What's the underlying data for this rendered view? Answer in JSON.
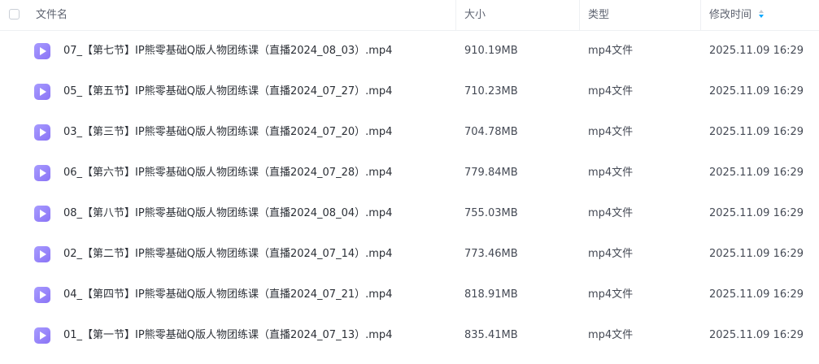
{
  "header": {
    "name_label": "文件名",
    "size_label": "大小",
    "type_label": "类型",
    "mtime_label": "修改时间",
    "sort_icon": "sort-desc-icon"
  },
  "accent_color": "#06a7ff",
  "file_icon_color": "#8a73f5",
  "files": [
    {
      "name": "07_【第七节】IP熊零基础Q版人物团练课（直播2024_08_03）.mp4",
      "size": "910.19MB",
      "type": "mp4文件",
      "mtime": "2025.11.09 16:29"
    },
    {
      "name": "05_【第五节】IP熊零基础Q版人物团练课（直播2024_07_27）.mp4",
      "size": "710.23MB",
      "type": "mp4文件",
      "mtime": "2025.11.09 16:29"
    },
    {
      "name": "03_【第三节】IP熊零基础Q版人物团练课（直播2024_07_20）.mp4",
      "size": "704.78MB",
      "type": "mp4文件",
      "mtime": "2025.11.09 16:29"
    },
    {
      "name": "06_【第六节】IP熊零基础Q版人物团练课（直播2024_07_28）.mp4",
      "size": "779.84MB",
      "type": "mp4文件",
      "mtime": "2025.11.09 16:29"
    },
    {
      "name": "08_【第八节】IP熊零基础Q版人物团练课（直播2024_08_04）.mp4",
      "size": "755.03MB",
      "type": "mp4文件",
      "mtime": "2025.11.09 16:29"
    },
    {
      "name": "02_【第二节】IP熊零基础Q版人物团练课（直播2024_07_14）.mp4",
      "size": "773.46MB",
      "type": "mp4文件",
      "mtime": "2025.11.09 16:29"
    },
    {
      "name": "04_【第四节】IP熊零基础Q版人物团练课（直播2024_07_21）.mp4",
      "size": "818.91MB",
      "type": "mp4文件",
      "mtime": "2025.11.09 16:29"
    },
    {
      "name": "01_【第一节】IP熊零基础Q版人物团练课（直播2024_07_13）.mp4",
      "size": "835.41MB",
      "type": "mp4文件",
      "mtime": "2025.11.09 16:29"
    }
  ]
}
